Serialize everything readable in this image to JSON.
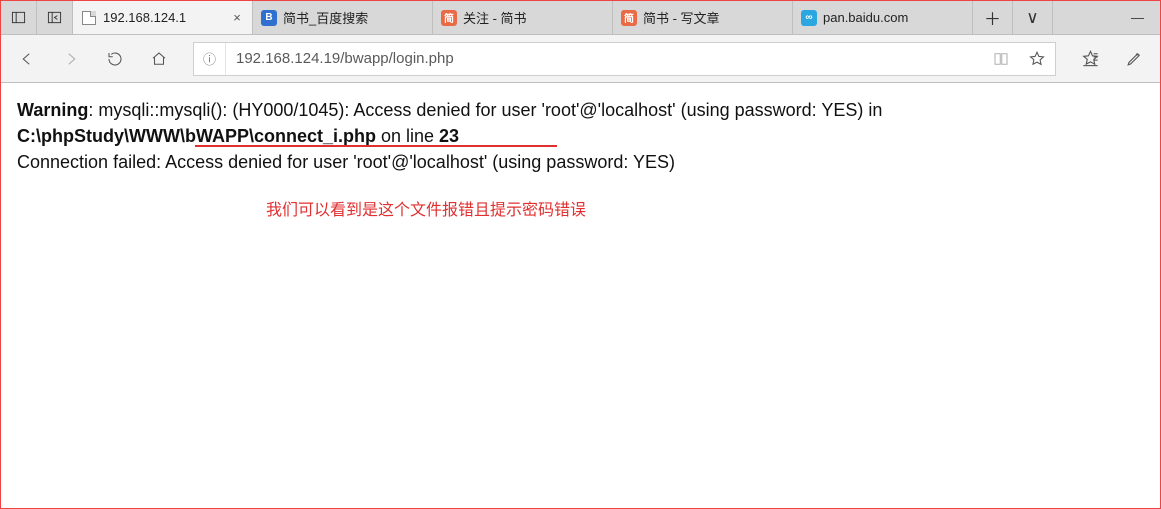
{
  "tabs": [
    {
      "label": "192.168.124.1",
      "fav": "page",
      "active": true,
      "closable": true
    },
    {
      "label": "简书_百度搜索",
      "fav": "baidu",
      "active": false,
      "closable": false
    },
    {
      "label": "关注 - 简书",
      "fav": "jianshu",
      "active": false,
      "closable": false
    },
    {
      "label": "简书 - 写文章",
      "fav": "jianshu",
      "active": false,
      "closable": false
    },
    {
      "label": "pan.baidu.com",
      "fav": "pan",
      "active": false,
      "closable": false
    }
  ],
  "url": "192.168.124.19/bwapp/login.php",
  "info_glyph": "ⓘ",
  "page": {
    "warning_label": "Warning",
    "warning_text": ": mysqli::mysqli(): (HY000/1045): Access denied for user 'root'@'localhost' (using password: YES) in ",
    "file_path": "C:\\phpStudy\\WWW\\bWAPP\\connect_i.php",
    "on_line": " on line ",
    "line_no": "23",
    "conn_failed": "Connection failed: Access denied for user 'root'@'localhost' (using password: YES)"
  },
  "annotation": "我们可以看到是这个文件报错且提示密码错误",
  "glyphs": {
    "plus": "＋",
    "chevron": "∨",
    "minimize": "—",
    "close": "×"
  }
}
